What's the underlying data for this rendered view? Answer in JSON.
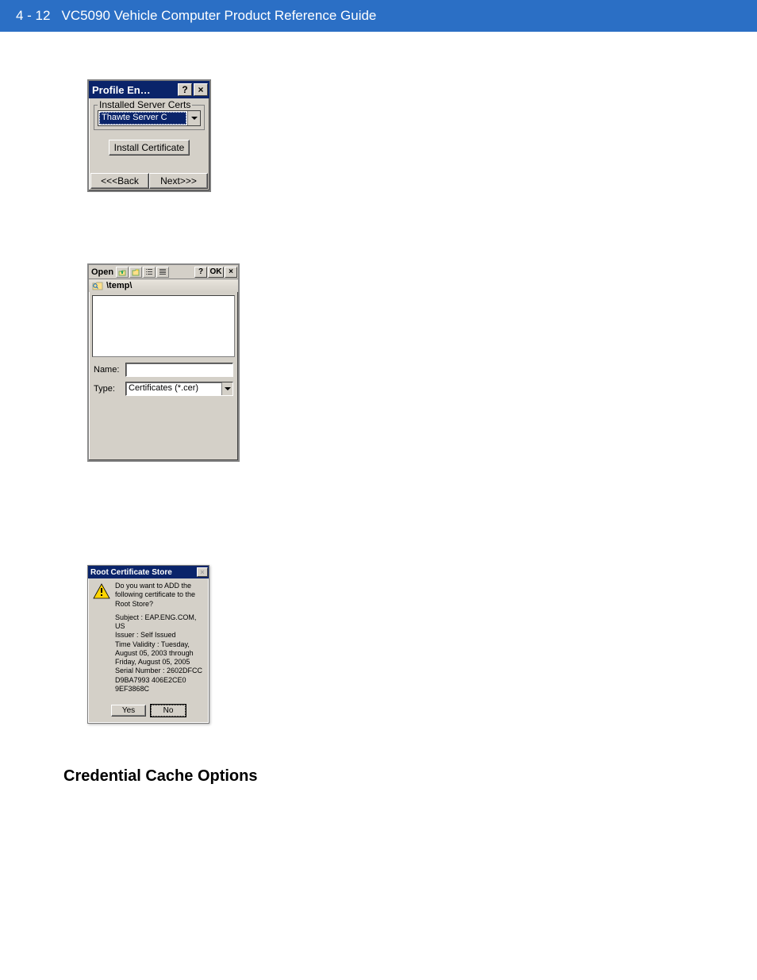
{
  "header": {
    "page_num": "4 - 12",
    "doc_title": "VC5090 Vehicle Computer Product Reference Guide"
  },
  "dlg1": {
    "title": "Profile En…",
    "help": "?",
    "close": "×",
    "group_label": "Installed Server Certs",
    "dropdown_value": "Thawte Server C",
    "install_btn": "Install Certificate",
    "back_btn": "<<<Back",
    "next_btn": "Next>>>"
  },
  "dlg2": {
    "open_label": "Open",
    "help": "?",
    "ok": "OK",
    "close": "×",
    "path": "\\temp\\",
    "name_label": "Name:",
    "name_value": "",
    "type_label": "Type:",
    "type_value": "Certificates (*.cer)"
  },
  "dlg3": {
    "title": "Root Certificate Store",
    "close": "×",
    "question": "Do you want to ADD the following certificate to the Root Store?",
    "details": "Subject : EAP.ENG.COM, US\nIssuer : Self Issued\nTime Validity : Tuesday, August 05, 2003 through Friday, August 05, 2005\nSerial Number : 2602DFCC D9BA7993 406E2CE0 9EF3868C",
    "yes": "Yes",
    "no": "No"
  },
  "section_heading": "Credential Cache Options"
}
